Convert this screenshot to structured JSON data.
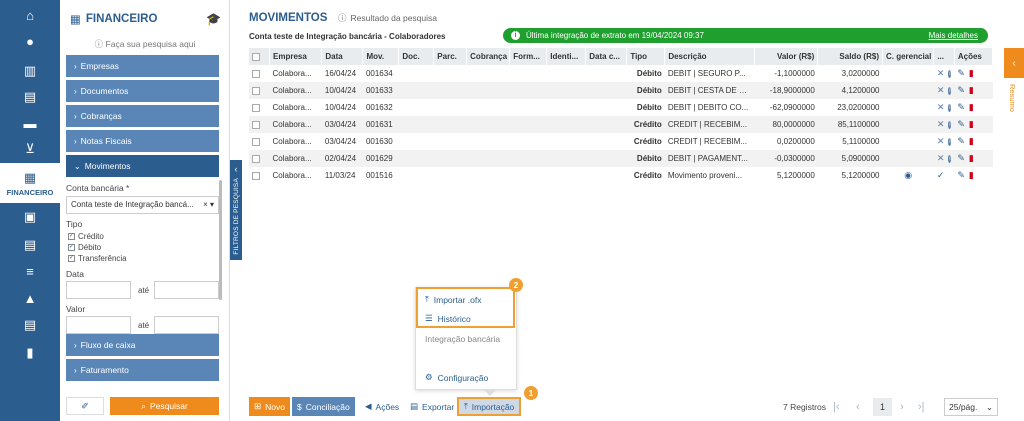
{
  "rail": {
    "items": [
      "home-icon",
      "user-icon",
      "building-icon",
      "document-icon",
      "truck-icon",
      "cart-icon"
    ],
    "active_label": "FINANCEIRO",
    "lower": [
      "boxes-icon",
      "file-icon",
      "list-check-icon",
      "warning-icon",
      "report-icon",
      "chart-icon"
    ]
  },
  "sidebar": {
    "title": "FINANCEIRO",
    "search_hint": "Faça sua pesquisa aqui",
    "sections": [
      "Empresas",
      "Documentos",
      "Cobranças",
      "Notas Fiscais",
      "Movimentos"
    ],
    "account_label": "Conta bancária *",
    "account_value": "Conta teste de Integração bancá...",
    "type_label": "Tipo",
    "types": [
      "Crédito",
      "Débito",
      "Transferência"
    ],
    "date_label": "Data",
    "value_label": "Valor",
    "ate": "até",
    "bottom_sections": [
      "Fluxo de caixa",
      "Faturamento"
    ],
    "search_button": "Pesquisar"
  },
  "strip_label": "FILTROS DE PESQUISA",
  "main": {
    "title": "MOVIMENTOS",
    "result_label": "Resultado da pesquisa",
    "account_name": "Conta teste de Integração bancária - Colaboradores",
    "banner": {
      "text": "Última integração de extrato em 19/04/2024 09:37",
      "link": "Mais detalhes"
    }
  },
  "table": {
    "columns": [
      "Empresa",
      "Data",
      "Mov.",
      "Doc.",
      "Parc.",
      "Cobrança",
      "Form...",
      "Identi...",
      "Data c...",
      "Tipo",
      "Descrição",
      "Valor (R$)",
      "Saldo (R$)",
      "C. gerencial",
      "...",
      "Ações"
    ],
    "rows": [
      {
        "empresa": "Colabora...",
        "data": "16/04/24",
        "mov": "001634",
        "tipo": "Débito",
        "desc": "DEBIT | SEGURO P...",
        "valor": "-1,1000000",
        "saldo": "3,0200000",
        "eye": false,
        "check": false
      },
      {
        "empresa": "Colabora...",
        "data": "10/04/24",
        "mov": "001633",
        "tipo": "Débito",
        "desc": "DEBIT | CESTA DE R...",
        "valor": "-18,9000000",
        "saldo": "4,1200000",
        "eye": false,
        "check": false
      },
      {
        "empresa": "Colabora...",
        "data": "10/04/24",
        "mov": "001632",
        "tipo": "Débito",
        "desc": "DEBIT | DEBITO CO...",
        "valor": "-62,0900000",
        "saldo": "23,0200000",
        "eye": false,
        "check": false
      },
      {
        "empresa": "Colabora...",
        "data": "03/04/24",
        "mov": "001631",
        "tipo": "Crédito",
        "desc": "CREDIT | RECEBIM...",
        "valor": "80,0000000",
        "saldo": "85,1100000",
        "eye": false,
        "check": false
      },
      {
        "empresa": "Colabora...",
        "data": "03/04/24",
        "mov": "001630",
        "tipo": "Crédito",
        "desc": "CREDIT | RECEBIM...",
        "valor": "0,0200000",
        "saldo": "5,1100000",
        "eye": false,
        "check": false
      },
      {
        "empresa": "Colabora...",
        "data": "02/04/24",
        "mov": "001629",
        "tipo": "Débito",
        "desc": "DEBIT | PAGAMENT...",
        "valor": "-0,0300000",
        "saldo": "5,0900000",
        "eye": false,
        "check": false
      },
      {
        "empresa": "Colabora...",
        "data": "11/03/24",
        "mov": "001516",
        "tipo": "Crédito",
        "desc": "Movimento proveni...",
        "valor": "5,1200000",
        "saldo": "5,1200000",
        "eye": true,
        "check": true
      }
    ]
  },
  "popup": {
    "import_ofx": "Importar .ofx",
    "history": "Histórico",
    "bank_integration": "Integração bancária",
    "config": "Configuração",
    "badge1": "1",
    "badge2": "2"
  },
  "toolbar": {
    "new": "Novo",
    "conciliation": "Conciliação",
    "actions": "Ações",
    "export": "Exportar",
    "import": "Importação"
  },
  "pagination": {
    "records": "7 Registros",
    "page": "1",
    "page_size": "25/pág."
  },
  "right_panel": {
    "label": "Resumo"
  },
  "colors": {
    "primary": "#2c5d8f",
    "accent": "#ef8b1d",
    "success": "#1f9f2e",
    "danger": "#d0021b",
    "highlight": "#f0a030"
  }
}
